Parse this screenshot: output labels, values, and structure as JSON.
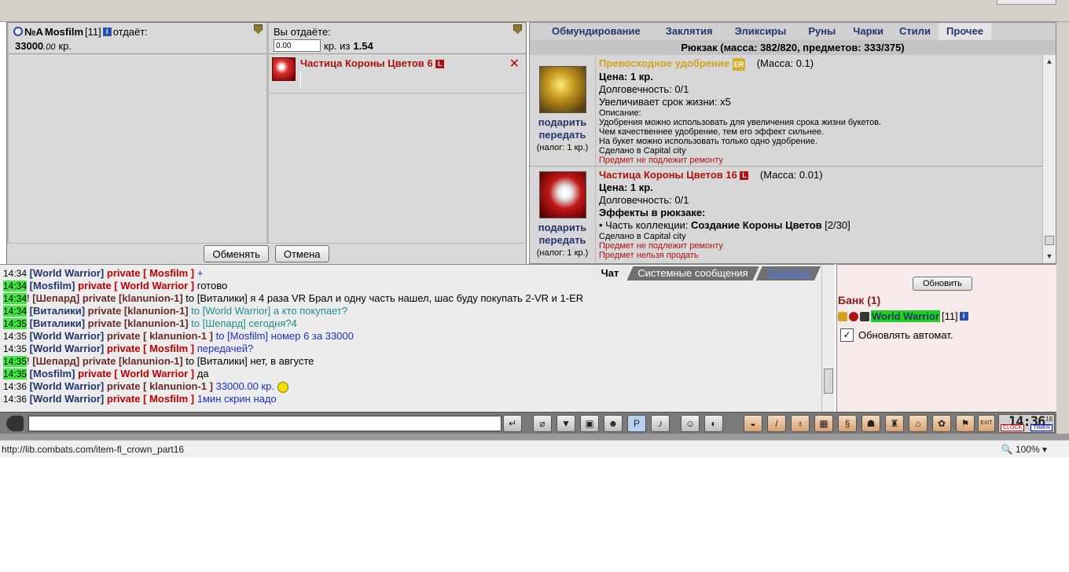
{
  "trade": {
    "partner": {
      "clan": "№A",
      "name": "Mosfilm",
      "level": "[11]",
      "info": "i",
      "gives_label": "отдаёт:",
      "amount_value": "33000",
      "amount_decimals": ".00",
      "currency": "кр."
    },
    "self": {
      "gives_label": "Вы отдаёте:",
      "amount_input": "0.00",
      "of_label": "кр. из",
      "balance": "1.54",
      "item_name": "Частица Короны Цветов 6",
      "item_badge": "L",
      "remove": "✕"
    },
    "exchange_button": "Обменять",
    "cancel_button": "Отмена"
  },
  "inventory": {
    "tabs": [
      "Обмундирование",
      "Заклятия",
      "Эликсиры",
      "Руны",
      "Чарки",
      "Стили",
      "Прочее"
    ],
    "active_tab": "Прочее",
    "bag_summary": "Рюкзак (масса: 382/820, предметов: 333/375)",
    "items": [
      {
        "name": "Превосходное удобрение",
        "badge": "ER",
        "mass": "(Масса: 0.1)",
        "price": "Цена: 1 кр.",
        "durability": "Долговечность: 0/1",
        "effect": "Увеличивает срок жизни: x5",
        "desc_title": "Описание:",
        "desc1": "Удобрения можно использовать для увеличения срока жизни букетов.",
        "desc2": "Чем качественнее удобрение, тем его эффект сильнее.",
        "desc3": "На букет можно использовать только одно удобрение.",
        "made": "Сделано в Capital city",
        "note1": "Предмет не подлежит ремонту"
      },
      {
        "name": "Частица Короны Цветов 16",
        "badge": "L",
        "mass": "(Масса: 0.01)",
        "price": "Цена: 1 кр.",
        "durability": "Долговечность: 0/1",
        "effects_title": "Эффекты в рюкзаке:",
        "collection_prefix": "• Часть коллекции:",
        "collection_name": "Создание Короны Цветов",
        "collection_count": "[2/30]",
        "made": "Сделано в Capital city",
        "note1": "Предмет не подлежит ремонту",
        "note2": "Предмет нельзя продать"
      }
    ],
    "gift_link": "подарить",
    "transfer_link": "передать",
    "tax": "(налог: 1 кр.)"
  },
  "chat": {
    "tabs": [
      "Чат",
      "Системные сообщения",
      "Торговля"
    ],
    "lines": [
      {
        "time": "14:34",
        "from": "[World Warrior]",
        "priv": "private [ Mosfilm ]",
        "text": "+"
      },
      {
        "time": "14:34",
        "from": "[Mosfilm]",
        "priv": "private [ World Warrior ]",
        "text": "готово"
      },
      {
        "time": "14:34",
        "prefix": "!",
        "from": "[Шепард]",
        "priv": "private [klanunion-1]",
        "text": "to [Виталики] я 4 раза VR Брал и одну часть нашел, шас буду покупать 2-VR и 1-ER"
      },
      {
        "time": "14:34",
        "from": "[Виталики]",
        "priv": "private [klanunion-1]",
        "text": "to [World Warrior] а кто покупает?"
      },
      {
        "time": "14:35",
        "from": "[Виталики]",
        "priv": "private [klanunion-1]",
        "text": "to [Шепард] сегодня?4"
      },
      {
        "time": "14:35",
        "from": "[World Warrior]",
        "priv": "private [ klanunion-1 ]",
        "text": "to [Mosfilm] номер 6 за 33000"
      },
      {
        "time": "14:35",
        "from": "[World Warrior]",
        "priv": "private [ Mosfilm ]",
        "text": "передачей?"
      },
      {
        "time": "14:35",
        "prefix": "!",
        "from": "[Шепард]",
        "priv": "private [klanunion-1]",
        "text": "to [Виталики] нет, в августе"
      },
      {
        "time": "14:35",
        "from": "[Mosfilm]",
        "priv": "private [ World Warrior ]",
        "text": "да"
      },
      {
        "time": "14:36",
        "from": "[World Warrior]",
        "priv": "private [ klanunion-1 ]",
        "text": "33000.00 кр."
      },
      {
        "time": "14:36",
        "from": "[World Warrior]",
        "priv": "private [ Mosfilm ]",
        "text": "1мин скрин надо"
      }
    ]
  },
  "side": {
    "refresh": "Обновить",
    "bank": "Банк (1)",
    "user": "World Warrior",
    "level": "[11]",
    "auto": "Обновлять автомат."
  },
  "clock": {
    "time": "14:36",
    "sec": "18",
    "b1": "CLOCK",
    "b2": "TIMER"
  },
  "status": {
    "url": "http://lib.combats.com/item-fl_crown_part16",
    "zoom": "100%"
  }
}
